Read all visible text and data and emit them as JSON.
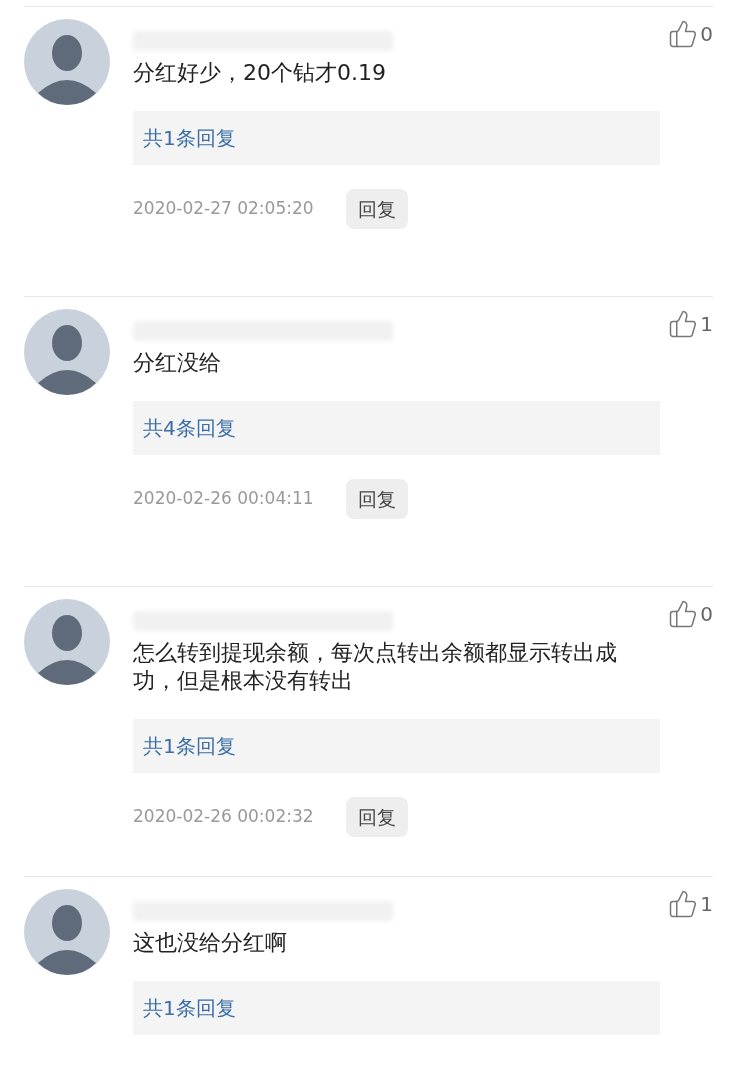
{
  "comments": [
    {
      "likes": "0",
      "text": "分红好少，20个钻才0.19",
      "replies": "共1条回复",
      "time": "2020-02-27 02:05:20",
      "reply_button": "回复"
    },
    {
      "likes": "1",
      "text": "分红没给",
      "replies": "共4条回复",
      "time": "2020-02-26 00:04:11",
      "reply_button": "回复"
    },
    {
      "likes": "0",
      "text": "怎么转到提现余额，每次点转出余额都显示转出成功，但是根本没有转出",
      "replies": "共1条回复",
      "time": "2020-02-26 00:02:32",
      "reply_button": "回复"
    },
    {
      "likes": "1",
      "text": "这也没给分红啊",
      "replies": "共1条回复"
    }
  ]
}
